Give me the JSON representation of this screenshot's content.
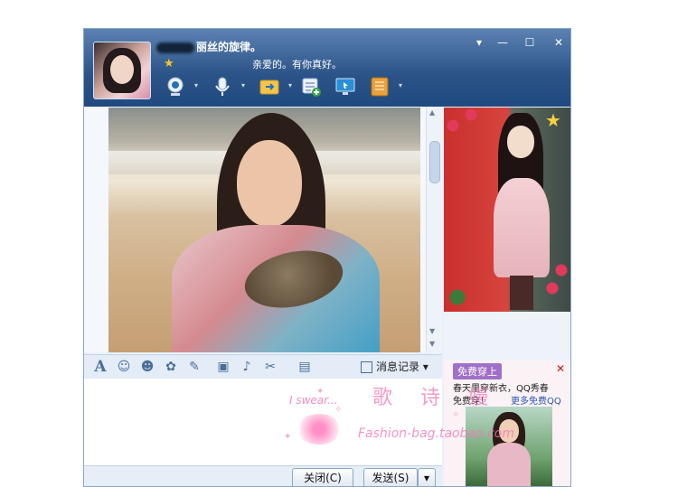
{
  "contact": {
    "name": "丽丝的旋律。",
    "signature": "亲爱的。有你真好。"
  },
  "window_controls": {
    "menu": "▾",
    "minimize": "—",
    "maximize": "☐",
    "close": "✕"
  },
  "toolbar": {
    "icons": [
      "webcam-icon",
      "microphone-icon",
      "file-transfer-icon",
      "chat-add-icon",
      "remote-assist-icon",
      "app-box-icon"
    ]
  },
  "format_bar": {
    "icons": [
      "font-icon",
      "emoji-icon",
      "magic-face-icon",
      "graffiti-icon",
      "edit-icon",
      "picture-icon",
      "music-icon",
      "screenshot-icon",
      "wallet-icon"
    ],
    "history_label": "消息记录"
  },
  "buttons": {
    "close_label": "关闭(C)",
    "send_label": "发送(S)"
  },
  "ad": {
    "tag": "免费穿上",
    "line1": "春天里穿新衣，QQ秀春",
    "line2": "免费穿！",
    "link": "更多免费QQ",
    "close": "✕"
  },
  "watermark": {
    "swear": "I swear...",
    "name": "歌 诗 嫚",
    "url": "Fashion-bag.taobao.com"
  },
  "colors": {
    "titlebar": "#2c5387",
    "accent": "#4a6f99",
    "ad_tag": "#a070c9",
    "watermark": "#f07ab9"
  }
}
